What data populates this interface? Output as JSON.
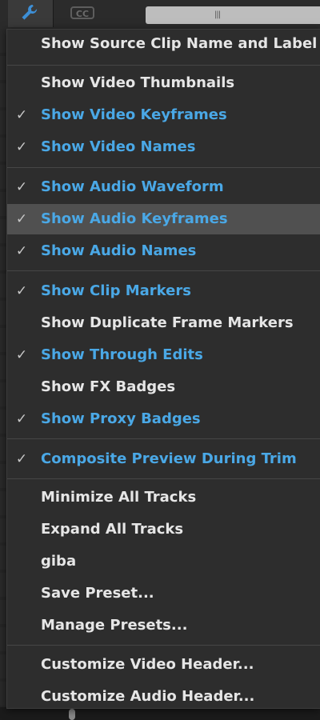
{
  "toolbar": {
    "wrench_icon": "wrench-icon",
    "cc_label": "CC",
    "scrub_handle": "|||"
  },
  "menu": {
    "items": [
      {
        "label": "Show Source Clip Name and Label",
        "checked": false
      },
      {
        "label": "Show Video Thumbnails",
        "checked": false
      },
      {
        "label": "Show Video Keyframes",
        "checked": true
      },
      {
        "label": "Show Video Names",
        "checked": true
      },
      {
        "label": "Show Audio Waveform",
        "checked": true
      },
      {
        "label": "Show Audio Keyframes",
        "checked": true,
        "highlighted": true
      },
      {
        "label": "Show Audio Names",
        "checked": true
      },
      {
        "label": "Show Clip Markers",
        "checked": true
      },
      {
        "label": "Show Duplicate Frame Markers",
        "checked": false
      },
      {
        "label": "Show Through Edits",
        "checked": true
      },
      {
        "label": "Show FX Badges",
        "checked": false
      },
      {
        "label": "Show Proxy Badges",
        "checked": true
      },
      {
        "label": "Composite Preview During Trim",
        "checked": true
      },
      {
        "label": "Minimize All Tracks",
        "checked": false
      },
      {
        "label": "Expand All Tracks",
        "checked": false
      },
      {
        "label": "giba",
        "checked": false
      },
      {
        "label": "Save Preset...",
        "checked": false
      },
      {
        "label": "Manage Presets...",
        "checked": false
      },
      {
        "label": "Customize Video Header...",
        "checked": false
      },
      {
        "label": "Customize Audio Header...",
        "checked": false
      }
    ],
    "check_glyph": "✓"
  },
  "colors": {
    "checked_text": "#4aa8e6",
    "unchecked_text": "#e6e6e6",
    "highlight_bg": "#505050",
    "menu_bg": "#2d2d2d"
  }
}
